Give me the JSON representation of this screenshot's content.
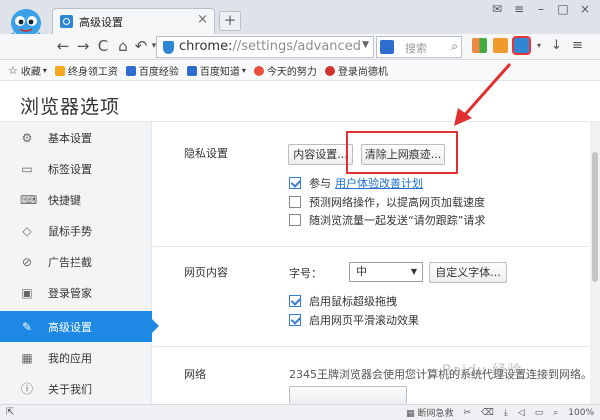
{
  "tab": {
    "title": "高级设置",
    "close": "×",
    "new_tab": "+"
  },
  "window": {
    "skin": "✉",
    "menu": "≡",
    "minimize": "–",
    "maximize": "□",
    "close": "×"
  },
  "toolbar": {
    "back": "←",
    "forward": "→",
    "reload": "C",
    "home": "⌂",
    "undo": "↶",
    "undo_menu": "▾",
    "url_prefix": "chrome:",
    "url_rest": "//settings/advanced",
    "search_placeholder": "搜索",
    "download": "↓",
    "menu": "≡"
  },
  "bookmarks": {
    "favorites": "收藏",
    "items": [
      "终身领工资",
      "百度经验",
      "百度知道",
      "今天的努力",
      "登录尚德机"
    ]
  },
  "page": {
    "title": "浏览器选项"
  },
  "sidebar": {
    "items": [
      {
        "label": "基本设置",
        "icon": "⚙"
      },
      {
        "label": "标签设置",
        "icon": "▭"
      },
      {
        "label": "快捷键",
        "icon": "⌨"
      },
      {
        "label": "鼠标手势",
        "icon": "◇"
      },
      {
        "label": "广告拦截",
        "icon": "⊘"
      },
      {
        "label": "登录管家",
        "icon": "▣"
      },
      {
        "label": "高级设置",
        "icon": "✎"
      },
      {
        "label": "我的应用",
        "icon": "▦"
      },
      {
        "label": "关于我们",
        "icon": "ⓘ"
      }
    ]
  },
  "privacy": {
    "title": "隐私设置",
    "content_settings": "内容设置...",
    "clear_history": "清除上网痕迹...",
    "opt_experience_prefix": "参与",
    "opt_experience_link": "用户体验改善计划",
    "opt_predict": "预测网络操作，以提高网页加载速度",
    "opt_dnt": "随浏览流量一起发送“请勿跟踪”请求"
  },
  "webcontent": {
    "title": "网页内容",
    "font_size_label": "字号：",
    "font_size_value": "中",
    "custom_fonts": "自定义字体...",
    "opt_drag": "启用鼠标超级拖拽",
    "opt_smooth": "启用网页平滑滚动效果"
  },
  "network": {
    "title": "网络",
    "description": "2345王牌浏览器会使用您计算机的系统代理设置连接到网络。"
  },
  "watermark": "Baidu 经验",
  "status": {
    "left_icon": "⇱",
    "net_label": "断网急救",
    "zoom": "100%"
  },
  "colors": {
    "accent": "#1e88e5",
    "annotation": "#e03030"
  }
}
